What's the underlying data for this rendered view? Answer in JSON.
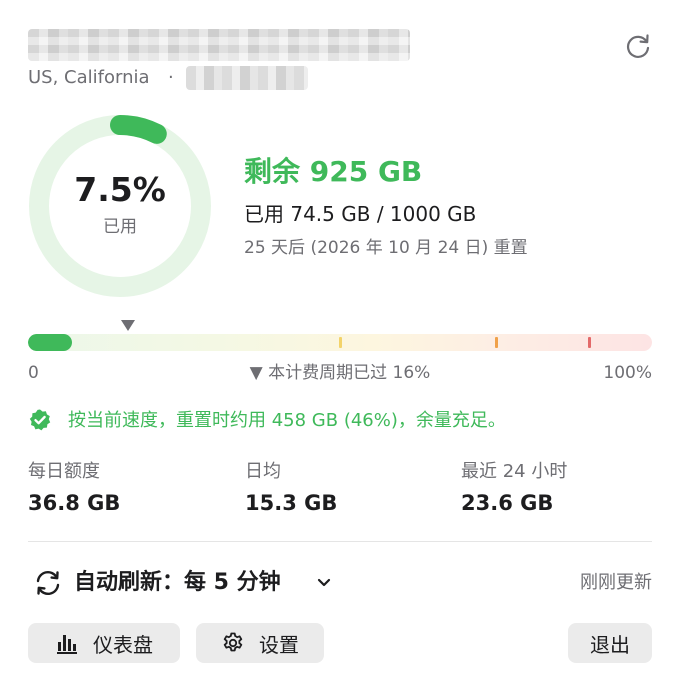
{
  "header": {
    "location": "US, California",
    "separator": "·",
    "refresh_icon": "refresh-icon"
  },
  "usage": {
    "percent_label": "7.5%",
    "percent_value": 7.5,
    "used_label": "已用",
    "remaining": "剩余 925 GB",
    "used_of_total": "已用 74.5 GB / 1000 GB",
    "reset": "25 天后 (2026 年 10 月 24 日) 重置"
  },
  "progress": {
    "fill_fraction": 0.075,
    "period_elapsed_fraction": 0.16,
    "min_label": "0",
    "period_label": "▼ 本计费周期已过 16%",
    "max_label": "100%",
    "ticks": [
      {
        "fraction": 0.5,
        "color": "#f3d36a"
      },
      {
        "fraction": 0.75,
        "color": "#f0a14a"
      },
      {
        "fraction": 0.9,
        "color": "#e36a6a"
      }
    ]
  },
  "status": {
    "icon": "check-badge-icon",
    "text": "按当前速度，重置时约用 458 GB (46%)，余量充足。"
  },
  "stats": [
    {
      "label": "每日额度",
      "value": "36.8 GB"
    },
    {
      "label": "日均",
      "value": "15.3 GB"
    },
    {
      "label": "最近 24 小时",
      "value": "23.6 GB"
    }
  ],
  "auto_refresh": {
    "label": "自动刷新：每 5 分钟",
    "updated": "刚刚更新"
  },
  "buttons": {
    "dashboard": "仪表盘",
    "settings": "设置",
    "quit": "退出"
  },
  "colors": {
    "accent_green": "#3fb95a",
    "ring_track": "#e6f5e6",
    "muted_text": "#6e6e73"
  }
}
